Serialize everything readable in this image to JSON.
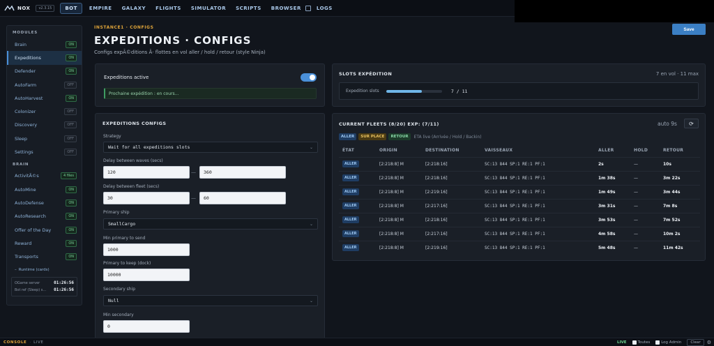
{
  "app": {
    "name": "NOX",
    "version": "v2.3.15"
  },
  "nav": {
    "items": [
      {
        "label": "BOT",
        "active": true
      },
      {
        "label": "EMPIRE"
      },
      {
        "label": "GALAXY"
      },
      {
        "label": "FLIGHTS"
      },
      {
        "label": "SIMULATOR"
      },
      {
        "label": "SCRIPTS"
      },
      {
        "label": "BROWSER"
      },
      {
        "label": "LOGS"
      }
    ]
  },
  "sidebar": {
    "modules_title": "MODULES",
    "modules": [
      {
        "label": "Brain",
        "badge": "ON"
      },
      {
        "label": "Expeditions",
        "badge": "ON",
        "active": true
      },
      {
        "label": "Defender",
        "badge": "ON"
      },
      {
        "label": "AutoFarm",
        "badge": "OFF"
      },
      {
        "label": "AutoHarvest",
        "badge": "ON"
      },
      {
        "label": "Colonizer",
        "badge": "OFF"
      },
      {
        "label": "Discovery",
        "badge": "OFF"
      },
      {
        "label": "Sleep",
        "badge": "OFF"
      },
      {
        "label": "Settings",
        "badge": "OFF"
      }
    ],
    "brain_title": "BRAIN",
    "brain": [
      {
        "label": "ActivitÃ©s",
        "badge": "4 files"
      },
      {
        "label": "AutoMine",
        "badge": "ON"
      },
      {
        "label": "AutoDefense",
        "badge": "ON"
      },
      {
        "label": "AutoResearch",
        "badge": "ON"
      },
      {
        "label": "Offer of the Day",
        "badge": "ON"
      },
      {
        "label": "Reward",
        "badge": "ON"
      },
      {
        "label": "Transports",
        "badge": "ON"
      }
    ],
    "runtime_toggle": "Runtime (cards)",
    "runtime": [
      {
        "label": "OGame server",
        "time": "01:26:56"
      },
      {
        "label": "Bot ref (Sleep) s...",
        "time": "01:26:56"
      }
    ]
  },
  "header": {
    "breadcrumb": "INSTANCE1 · CONFIGS",
    "title": "EXPEDITIONS · CONFIGS",
    "subtitle": "Configs expÃ©ditions Â· flottes en vol aller / hold / retour (style Ninja)",
    "save_label": "Save"
  },
  "active_panel": {
    "label": "Expeditions active",
    "enabled": true,
    "next_label": "Prochaine expédition :",
    "next_value": "en cours..."
  },
  "configs": {
    "title": "EXPEDITIONS CONFIGS",
    "strategy_label": "Strategy",
    "strategy_value": "Wait for all expeditions slots",
    "delay_waves_label": "Delay between waves (secs)",
    "delay_waves_min": "120",
    "delay_waves_max": "360",
    "delay_fleet_label": "Delay between fleet (secs)",
    "delay_fleet_min": "30",
    "delay_fleet_max": "60",
    "range_sep": "—",
    "primary_ship_label": "Primary ship",
    "primary_ship_value": "SmallCargo",
    "min_primary_label": "Min primary to send",
    "min_primary_value": "1000",
    "primary_keep_label": "Primary to keep (dock)",
    "primary_keep_value": "10000",
    "secondary_ship_label": "Secondary ship",
    "secondary_ship_value": "Null",
    "min_secondary_label": "Min secondary",
    "min_secondary_value": "0"
  },
  "slots": {
    "title": "SLOTS EXPÉDITION",
    "summary": "7 en vol · 11 max",
    "label": "Expedition slots",
    "count": "7 / 11",
    "fill_fraction": 0.636
  },
  "fleets": {
    "title": "CURRENT FLEETS (8/20) EXP: (7/11)",
    "auto_label": "auto 9s",
    "legend": {
      "aller": "ALLER",
      "place": "SUR PLACE",
      "retour": "RETOUR",
      "note": "ETA live (Arrivée / Hold / Backin)"
    },
    "columns": [
      "ÉTAT",
      "ORIGIN",
      "DESTINATION",
      "VAISSEAUX",
      "ALLER",
      "HOLD",
      "RETOUR"
    ],
    "rows": [
      {
        "state": "ALLER",
        "origin": "[2:218:8] M",
        "dest": "[2:218:16]",
        "ships": "SC:13 844  SP:1  RE:1  PF:1",
        "aller": "2s",
        "hold": "—",
        "retour": "10s"
      },
      {
        "state": "ALLER",
        "origin": "[2:218:8] M",
        "dest": "[2:218:16]",
        "ships": "SC:13 844  SP:1  RE:1  PF:1",
        "aller": "1m 38s",
        "hold": "—",
        "retour": "3m 22s"
      },
      {
        "state": "ALLER",
        "origin": "[2:218:8] M",
        "dest": "[2:219:16]",
        "ships": "SC:13 844  SP:1  RE:1  PF:1",
        "aller": "1m 49s",
        "hold": "—",
        "retour": "3m 44s"
      },
      {
        "state": "ALLER",
        "origin": "[2:218:8] M",
        "dest": "[2:217:16]",
        "ships": "SC:13 844  SP:1  RE:1  PF:1",
        "aller": "3m 31s",
        "hold": "—",
        "retour": "7m 8s"
      },
      {
        "state": "ALLER",
        "origin": "[2:218:8] M",
        "dest": "[2:218:16]",
        "ships": "SC:13 844  SP:1  RE:1  PF:1",
        "aller": "3m 53s",
        "hold": "—",
        "retour": "7m 52s"
      },
      {
        "state": "ALLER",
        "origin": "[2:218:8] M",
        "dest": "[2:217:16]",
        "ships": "SC:13 844  SP:1  RE:1  PF:1",
        "aller": "4m 58s",
        "hold": "—",
        "retour": "10m 2s"
      },
      {
        "state": "ALLER",
        "origin": "[2:218:8] M",
        "dest": "[2:219:16]",
        "ships": "SC:13 844  SP:1  RE:1  PF:1",
        "aller": "5m 48s",
        "hold": "—",
        "retour": "11m 42s"
      }
    ]
  },
  "console": {
    "label": "CONSOLE",
    "sep": "·",
    "status": "LIVE",
    "live": "LIVE",
    "toutes": "Toutes",
    "log_admin": "Log Admin",
    "clear": "Clear"
  },
  "colors": {
    "accent": "#4a90d9",
    "orange": "#e0a53a",
    "green": "#7ad39a"
  }
}
